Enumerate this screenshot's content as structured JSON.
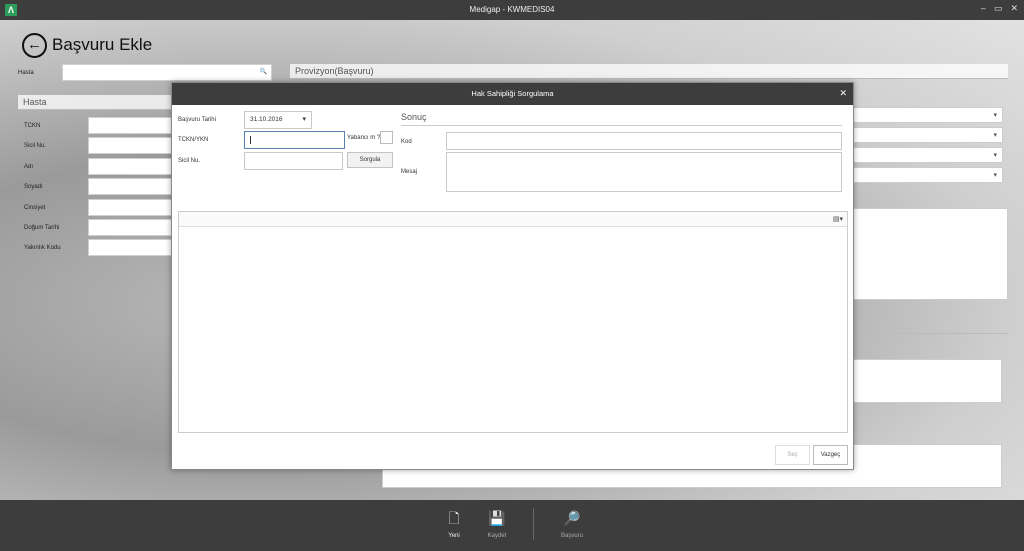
{
  "window": {
    "title": "Medigap - KWMEDIS04",
    "app_icon_glyph": "Λ",
    "controls": [
      "–",
      "▭",
      "✕"
    ]
  },
  "page": {
    "title": "Başvuru Ekle",
    "back_glyph": "←"
  },
  "search": {
    "label": "Hasta",
    "value": "",
    "icon_glyph": "🔍"
  },
  "hasta_section": {
    "title": "Hasta",
    "fields": [
      "TCKN",
      "Sicil Nu.",
      "Adı",
      "Soyadı",
      "Cinsiyet",
      "Doğum Tarihi",
      "Yakınlık Kodu"
    ]
  },
  "provizyon": {
    "title": "Provizyon(Başvuru)",
    "dropdown_glyph": "▾"
  },
  "dialog": {
    "title": "Hak Sahipliği Sorgulama",
    "close_glyph": "✕",
    "basvuru_tarihi_label": "Başvuru Tarihi",
    "basvuru_tarihi_value": "31.10.2016",
    "tckn_label": "TCKN/YKN",
    "tckn_value": "",
    "yabanci_label": "Yabancı m ?",
    "sicil_label": "Sicil Nu.",
    "sicil_value": "",
    "sorgula_button": "Sorgula",
    "sonuc_title": "Sonuç",
    "kod_label": "Kod",
    "mesaj_label": "Mesaj",
    "grid_menu_glyph": "▤▾",
    "sec_button": "Seç",
    "vazgec_button": "Vazgeç"
  },
  "bottom_toolbar": {
    "items": [
      {
        "label": "Yeni",
        "icon": "new-document-icon",
        "glyph": "🗋"
      },
      {
        "label": "Kaydet",
        "icon": "save-icon",
        "glyph": "💾"
      },
      {
        "label": "Başvuru",
        "icon": "basvuru-search-icon",
        "glyph": "🔎"
      }
    ]
  },
  "colors": {
    "titlebar": "#3d3d3d",
    "accent": "#2e9d5b",
    "focus_border": "#5a7fb3"
  }
}
